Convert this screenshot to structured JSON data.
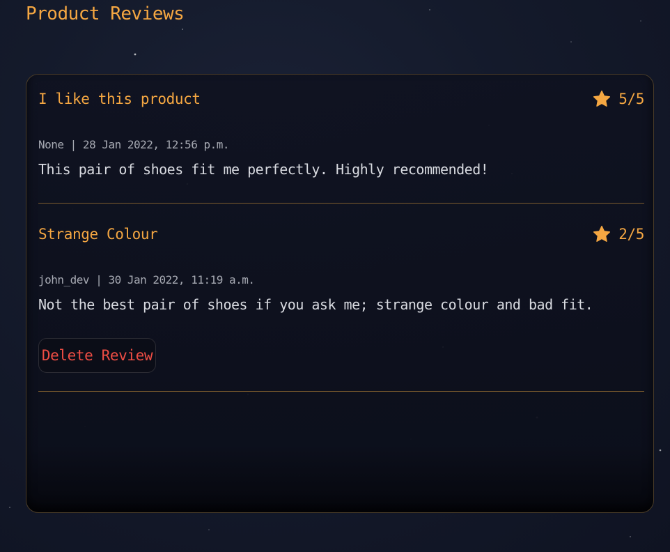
{
  "page": {
    "title": "Product Reviews"
  },
  "colors": {
    "accent": "#f5a742",
    "danger": "#ee4d44",
    "background": "#141a2b"
  },
  "reviews": [
    {
      "title": "I like this product",
      "rating_icon": "star-icon",
      "rating_value": 5,
      "rating_max": 5,
      "rating_text": "5/5",
      "meta": "None | 28 Jan 2022, 12:56 p.m.",
      "body": "This pair of shoes fit me perfectly. Highly recommended!"
    },
    {
      "title": "Strange Colour",
      "rating_icon": "star-icon",
      "rating_value": 2,
      "rating_max": 5,
      "rating_text": "2/5",
      "meta": "john_dev | 30 Jan 2022, 11:19 a.m.",
      "body": "Not the best pair of shoes if you ask me; strange colour and bad fit.",
      "delete_label": "Delete Review"
    }
  ]
}
